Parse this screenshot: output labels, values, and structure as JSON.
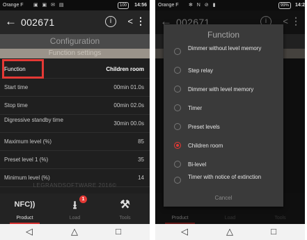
{
  "status_bar": {
    "carrier": "Orange F",
    "icons_left": "▣ ▣ ✉ ▤",
    "icons_right": "✻ N ⊘ ▮",
    "battery_left": "100",
    "time_left": "14:56",
    "battery_right": "99%",
    "time_right": "14:2"
  },
  "toolbar": {
    "back_icon": "←",
    "title": "002671",
    "info_icon": "i",
    "share_icon": "<",
    "more_icon": "⋮"
  },
  "config_header": "Configuration",
  "settings_header": "Function settings",
  "settings": [
    {
      "label": "Function",
      "value": "Children room"
    },
    {
      "label": "Start time",
      "value": "00min 01.0s"
    },
    {
      "label": "Stop time",
      "value": "00min 02.0s"
    },
    {
      "label": "Digressive standby time",
      "value": "30min 00.0s"
    },
    {
      "label": "Maximum level (%)",
      "value": "85"
    },
    {
      "label": "Preset level 1 (%)",
      "value": "35"
    },
    {
      "label": "Minimum level (%)",
      "value": "14"
    }
  ],
  "footer_brand": "LEGRANDSOFTWARE 2016©",
  "bottom_nav": [
    {
      "label": "Product",
      "icon": "NFC))",
      "active": true
    },
    {
      "label": "Load",
      "icon": "⭳",
      "badge": "1",
      "active": false
    },
    {
      "label": "Tools",
      "icon": "⚒",
      "active": false
    }
  ],
  "system_nav": {
    "back": "◁",
    "home": "△",
    "recent": "□"
  },
  "dialog": {
    "title": "Function",
    "options": [
      {
        "label": "Dimmer without level memory",
        "selected": false
      },
      {
        "label": "Step relay",
        "selected": false
      },
      {
        "label": "Dimmer with level memory",
        "selected": false
      },
      {
        "label": "Timer",
        "selected": false
      },
      {
        "label": "Preset levels",
        "selected": false
      },
      {
        "label": "Children room",
        "selected": true
      },
      {
        "label": "Bi-level",
        "selected": false
      },
      {
        "label": "Timer with notice of extinction",
        "selected": false
      }
    ],
    "cancel": "Cancel"
  },
  "colors": {
    "accent_red": "#e53935",
    "background": "#1f1f1f",
    "dialog": "#3a3a3a"
  }
}
